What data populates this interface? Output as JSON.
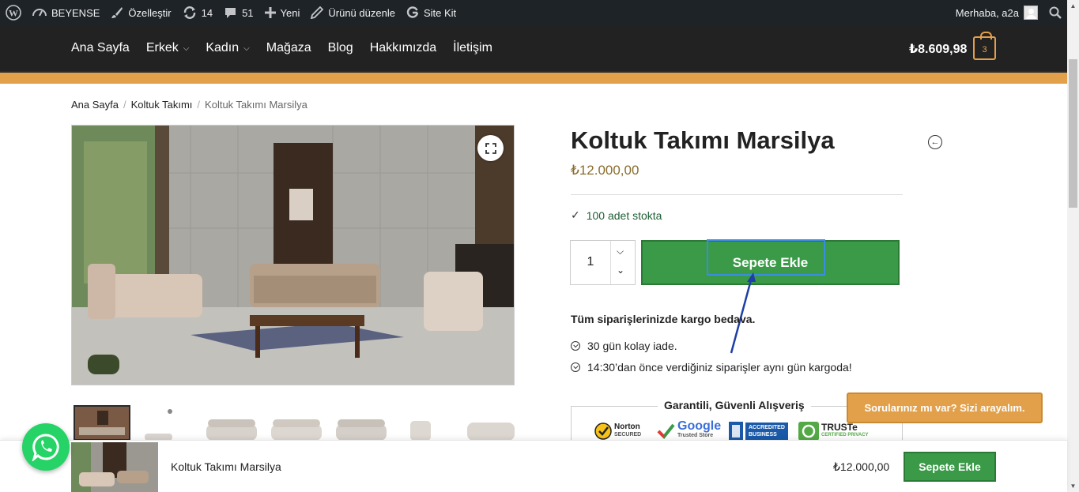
{
  "admin_bar": {
    "site_name": "BEYENSE",
    "customize": "Özelleştir",
    "updates_count": "14",
    "comments_count": "51",
    "new": "Yeni",
    "edit_product": "Ürünü düzenle",
    "site_kit": "Site Kit",
    "greeting": "Merhaba, a2a"
  },
  "nav": {
    "items": [
      "Ana Sayfa",
      "Erkek",
      "Kadın",
      "Mağaza",
      "Blog",
      "Hakkımızda",
      "İletişim"
    ],
    "cart_total": "₺8.609,98",
    "cart_count": "3"
  },
  "breadcrumb": {
    "home": "Ana Sayfa",
    "category": "Koltuk Takımı",
    "current": "Koltuk Takımı Marsilya"
  },
  "product": {
    "title": "Koltuk Takımı Marsilya",
    "price": "₺12.000,00",
    "stock": "100 adet stokta",
    "quantity": "1",
    "add_to_cart": "Sepete Ekle",
    "shipping_note": "Tüm siparişlerinizde kargo bedava.",
    "features": [
      "30 gün kolay iade.",
      "14:30’dan önce verdiğiniz siparişler aynı gün kargoda!"
    ],
    "trust_title": "Garantili, Güvenli Alışveriş",
    "badges": {
      "norton": "Norton",
      "norton_sub": "SECURED",
      "google": "Google",
      "google_sub": "Trusted Store",
      "bbb": "ACCREDITED",
      "bbb_sub": "BUSINESS",
      "truste": "TRUSTe",
      "truste_sub": "CERTIFIED PRIVACY"
    }
  },
  "callback_button": "Sorularınız mı var? Sizi arayalım.",
  "sticky": {
    "title": "Koltuk Takımı Marsilya",
    "price": "₺12.000,00",
    "add_to_cart": "Sepete Ekle"
  },
  "colors": {
    "accent_orange": "#e2a04b",
    "button_green": "#3a9a48",
    "header_dark": "#222222",
    "price_gold": "#8a6d2d"
  }
}
